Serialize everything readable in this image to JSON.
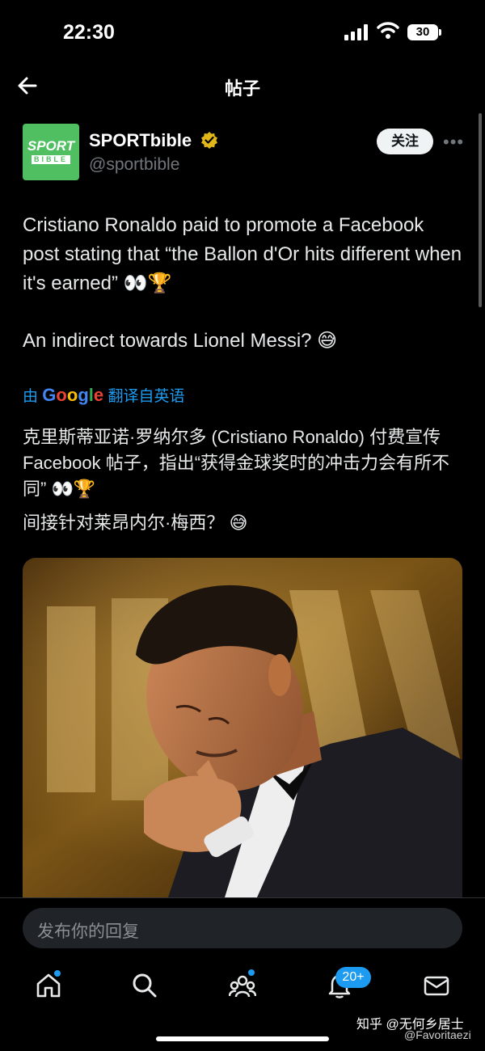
{
  "status_bar": {
    "time": "22:30",
    "battery": "30"
  },
  "header": {
    "title": "帖子"
  },
  "post": {
    "author_name": "SPORTbible",
    "author_handle": "@sportbible",
    "logo_line1": "SPORT",
    "logo_line2": "BIBLE",
    "follow_label": "关注",
    "text_en_1": "Cristiano Ronaldo paid to promote a Facebook post stating that “the Ballon d'Or hits different when it's earned” 👀🏆",
    "text_en_2": "An indirect towards Lionel Messi? 😅",
    "translate_prefix": "由",
    "translate_suffix": "翻译自英语",
    "text_zh_1": "克里斯蒂亚诺·罗纳尔多 (Cristiano Ronaldo) 付费宣传 Facebook 帖子，指出“获得金球奖时的冲击力会有所不同” 👀🏆",
    "text_zh_2": "间接针对莱昂内尔·梅西？ 😅"
  },
  "reply": {
    "placeholder": "发布你的回复"
  },
  "nav": {
    "items": [
      "home-icon",
      "search-icon",
      "communities-icon",
      "notifications-icon",
      "messages-icon"
    ],
    "notification_badge": "20+"
  },
  "watermark": {
    "line1": "知乎 @无何乡居士",
    "line2": "@Favoritaezi"
  },
  "colors": {
    "accent": "#1d9bf0",
    "background": "#000000",
    "logo_green": "#4fbf62"
  }
}
